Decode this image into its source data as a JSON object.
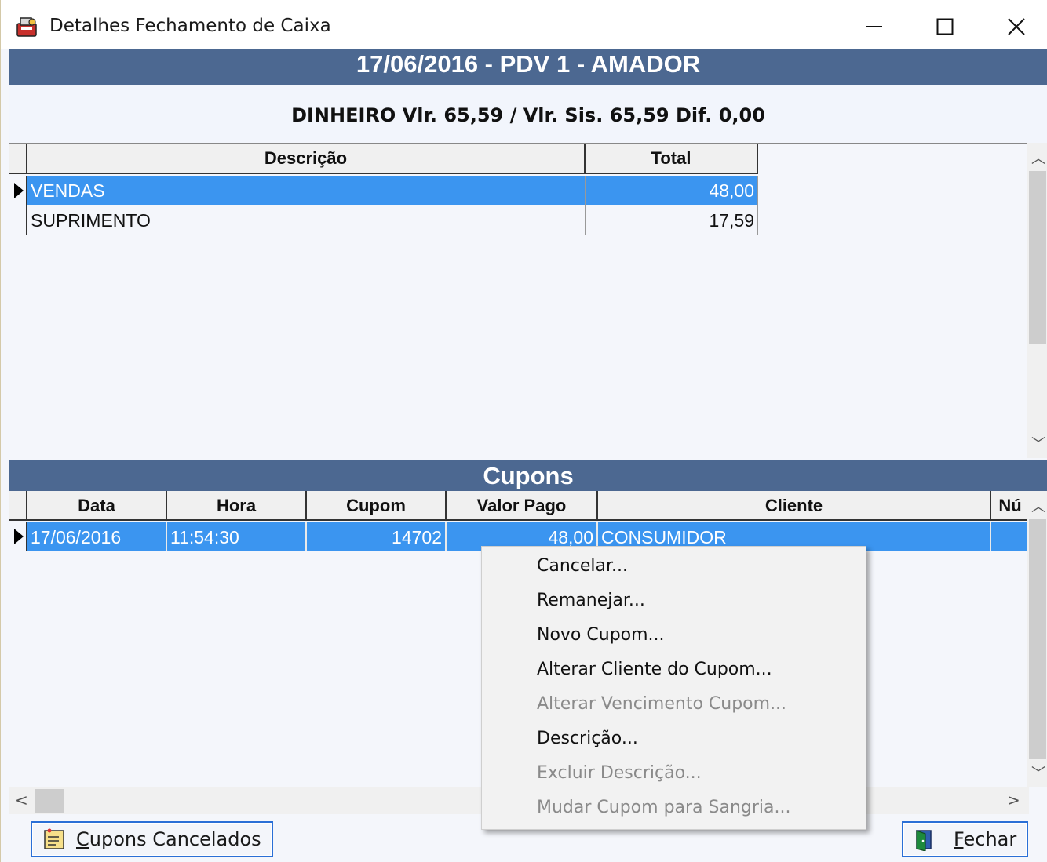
{
  "window": {
    "title": "Detalhes Fechamento de Caixa"
  },
  "header": {
    "date_line": "17/06/2016 - PDV 1 - AMADOR",
    "summary": "DINHEIRO Vlr. 65,59 / Vlr. Sis. 65,59 Dif. 0,00"
  },
  "summary_grid": {
    "columns": [
      "Descrição",
      "Total"
    ],
    "rows": [
      {
        "descricao": "VENDAS",
        "total": "48,00",
        "selected": true
      },
      {
        "descricao": "SUPRIMENTO",
        "total": "17,59",
        "selected": false
      }
    ]
  },
  "cupons": {
    "title": "Cupons",
    "columns": [
      "Data",
      "Hora",
      "Cupom",
      "Valor Pago",
      "Cliente",
      "Nú"
    ],
    "rows": [
      {
        "data": "17/06/2016",
        "hora": "11:54:30",
        "cupom": "14702",
        "valor_pago": "48,00",
        "cliente": "CONSUMIDOR",
        "numero": ""
      }
    ]
  },
  "context_menu": {
    "items": [
      {
        "label": "Cancelar...",
        "enabled": true
      },
      {
        "label": "Remanejar...",
        "enabled": true
      },
      {
        "label": "Novo Cupom...",
        "enabled": true
      },
      {
        "label": "Alterar Cliente do Cupom...",
        "enabled": true
      },
      {
        "label": "Alterar Vencimento Cupom...",
        "enabled": false
      },
      {
        "label": "Descrição...",
        "enabled": true
      },
      {
        "label": "Excluir Descrição...",
        "enabled": false
      },
      {
        "label": "Mudar Cupom para Sangria...",
        "enabled": false
      }
    ]
  },
  "buttons": {
    "cancelados": "Cupons Cancelados",
    "fechar": "Fechar"
  },
  "colors": {
    "band": "#4c6891",
    "selection": "#3b95f0",
    "button_border": "#2a6fd6"
  },
  "icons": {
    "app": "cash-register-icon",
    "cancelados": "notepad-icon",
    "fechar": "exit-door-icon"
  }
}
